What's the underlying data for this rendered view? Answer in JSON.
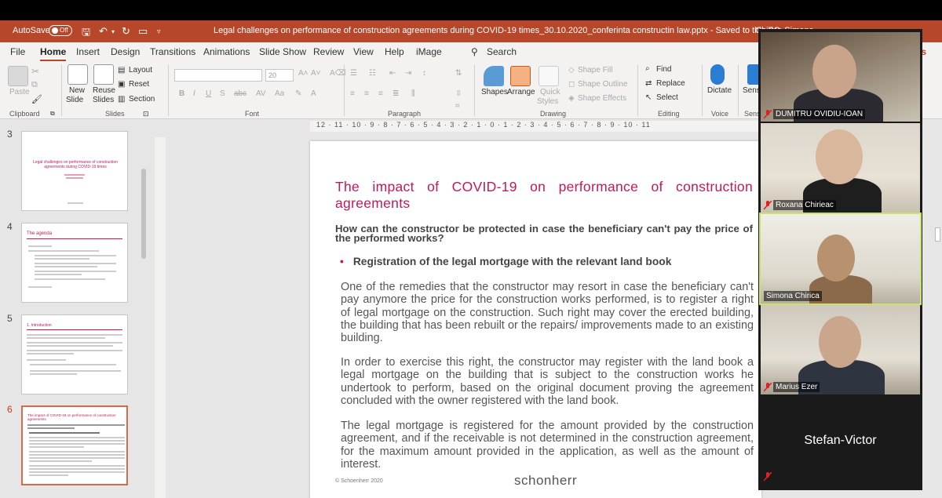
{
  "titlebar": {
    "autosave_label": "AutoSave",
    "autosave_state": "Off",
    "document_title": "Legal challenges on performance of construction agreements during COVID-19 times_30.10.2020_conferinta constructin law.pptx  -  Saved to this PC",
    "user_name": "Chirica Simona"
  },
  "ribbon_tabs": [
    "File",
    "Home",
    "Insert",
    "Design",
    "Transitions",
    "Animations",
    "Slide Show",
    "Review",
    "View",
    "Help",
    "iMage"
  ],
  "search_label": "Search",
  "ribbon": {
    "clipboard": {
      "paste": "Paste",
      "label": "Clipboard"
    },
    "slides": {
      "new_slide": "New",
      "new_slide2": "Slide",
      "reuse": "Reuse",
      "reuse2": "Slides",
      "layout": "Layout",
      "reset": "Reset",
      "section": "Section",
      "label": "Slides"
    },
    "font": {
      "size": "20",
      "label": "Font",
      "bold": "B",
      "italic": "I",
      "underline": "U",
      "strike": "S",
      "abc": "abc"
    },
    "paragraph": {
      "label": "Paragraph"
    },
    "drawing": {
      "shapes": "Shapes",
      "arrange": "Arrange",
      "quick": "Quick",
      "styles": "Styles",
      "shape_fill": "Shape Fill",
      "shape_outline": "Shape Outline",
      "shape_effects": "Shape Effects",
      "label": "Drawing"
    },
    "editing": {
      "find": "Find",
      "replace": "Replace",
      "select": "Select",
      "label": "Editing"
    },
    "voice": {
      "dictate": "Dictate",
      "label": "Voice"
    },
    "sensitivity": {
      "label": "Sensi",
      "label2": "Sensi"
    },
    "comments_tab": "nts"
  },
  "thumbnails": [
    {
      "num": "3",
      "title": "Legal challenges on performance of construction agreements during COVID-19 times"
    },
    {
      "num": "4",
      "title": "The agenda"
    },
    {
      "num": "5",
      "title": "1. Introduction"
    },
    {
      "num": "6",
      "title": "The impact of COVID-19 on performance of construction agreements"
    }
  ],
  "ruler_text": "12 · 11 · 10 · 9 · 8 · 7 · 6 · 5 · 4 · 3 · 2 · 1 · 0 · 1 · 2 · 3 · 4 · 5 · 6 · 7 · 8 · 9 · 10 · 11",
  "slide": {
    "title_line1": "The impact of COVID-19 on performance of construction",
    "title_line2": "agreements",
    "question": "How can the constructor be protected in case the beneficiary can't pay the price of the performed works?",
    "bullet": "Registration of the legal mortgage with the relevant land book",
    "para1": "One of the remedies that the constructor may resort in case the beneficiary can't pay anymore the price for the construction works performed, is to register a right of legal mortgage on the construction. Such right may cover the erected building, the building that has been rebuilt or the repairs/ improvements made to an existing building.",
    "para2": "In order to exercise this right, the constructor may register with the land book a legal mortgage on the building that is subject to the construction works he undertook to perform, based on the original document proving the agreement concluded with the owner registered with the land book.",
    "para3": "The legal mortgage is registered for the amount provided by the construction agreement, and if the receivable is not determined in the construction agreement, for the maximum amount provided in the application, as well as the amount of interest.",
    "footer_copyright": "© Schoenherr 2020",
    "footer_logo": "schonherr"
  },
  "participants": [
    {
      "name": "DUMITRU OVIDIU-IOAN"
    },
    {
      "name": "Roxana Chirieac"
    },
    {
      "name": "Simona Chirica"
    },
    {
      "name": "Marius Ezer"
    },
    {
      "name": "Stefan-Victor"
    }
  ],
  "colors": {
    "brand_red": "#b7472a",
    "title_pink": "#c2185b",
    "active_speaker": "#c8e26a"
  }
}
